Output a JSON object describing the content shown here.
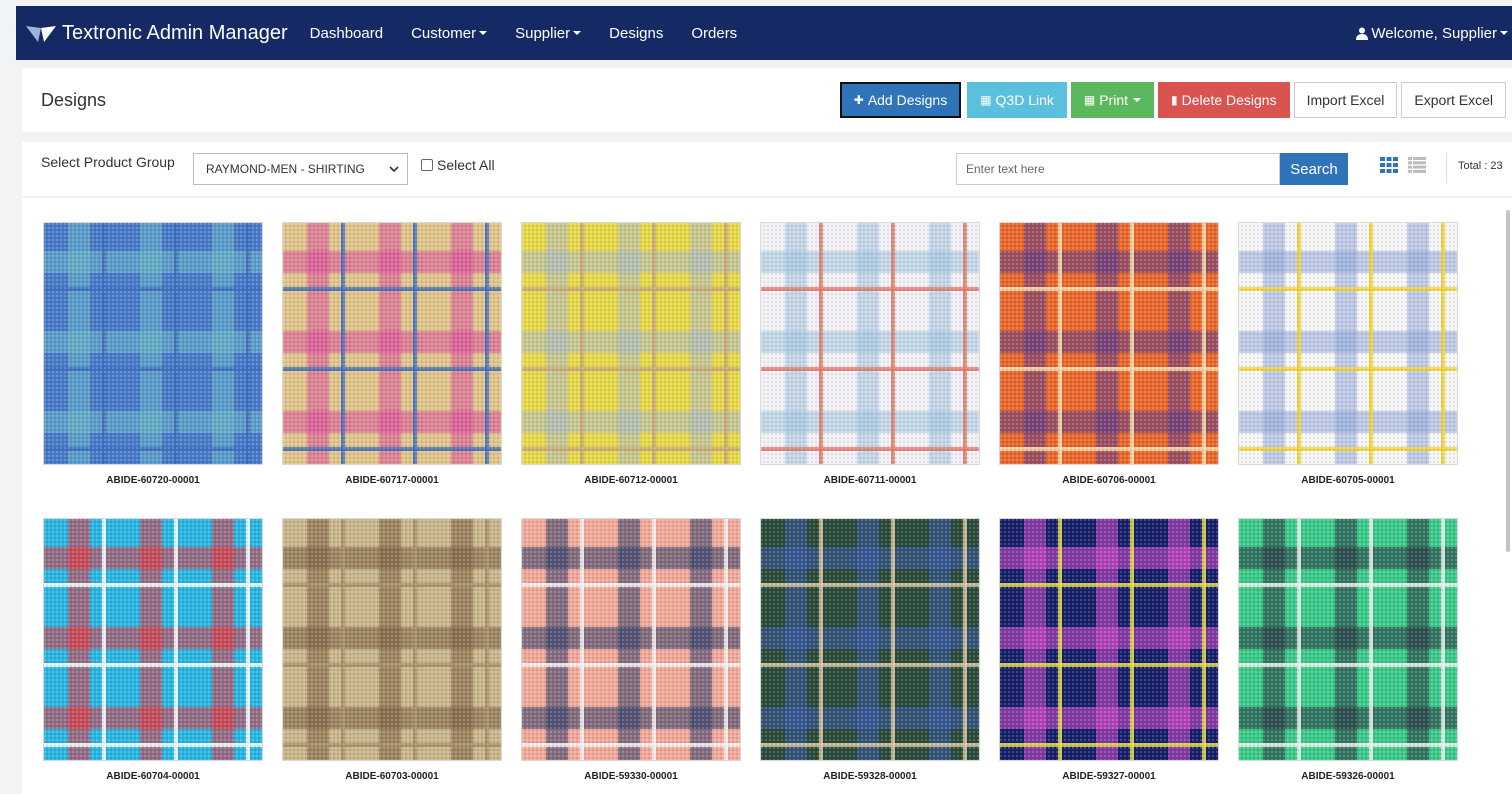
{
  "nav": {
    "brand": "Textronic Admin Manager",
    "items": [
      {
        "label": "Dashboard",
        "has_caret": false
      },
      {
        "label": "Customer",
        "has_caret": true
      },
      {
        "label": "Supplier",
        "has_caret": true
      },
      {
        "label": "Designs",
        "has_caret": false
      },
      {
        "label": "Orders",
        "has_caret": false
      }
    ],
    "welcome": "Welcome, Supplier",
    "bg_color": "#152a64"
  },
  "header": {
    "title": "Designs",
    "buttons": {
      "add": "Add Designs",
      "q3d": "Q3D Link",
      "print": "Print",
      "delete": "Delete Designs",
      "import": "Import Excel",
      "export": "Export Excel"
    }
  },
  "filter": {
    "label": "Select Product Group",
    "selected_group": "RAYMOND-MEN - SHIRTING",
    "select_all": "Select All",
    "search_placeholder": "Enter text here",
    "search_button": "Search",
    "total": "Total : 23"
  },
  "designs": [
    {
      "code": "ABIDE-60720-00001",
      "colors": [
        "#4a7bc8",
        "#6bb8c8",
        "#3f6fbf"
      ]
    },
    {
      "code": "ABIDE-60717-00001",
      "colors": [
        "#e0c48a",
        "#d94c9c",
        "#3f6fbf"
      ]
    },
    {
      "code": "ABIDE-60712-00001",
      "colors": [
        "#e8d94a",
        "#a8b8c8",
        "#c7a87a"
      ]
    },
    {
      "code": "ABIDE-60711-00001",
      "colors": [
        "#f2f2f6",
        "#9fc0dc",
        "#e07a6a"
      ]
    },
    {
      "code": "ABIDE-60706-00001",
      "colors": [
        "#e8672c",
        "#5a3a8a",
        "#f3e0b0"
      ]
    },
    {
      "code": "ABIDE-60705-00001",
      "colors": [
        "#f5f5f5",
        "#8fa6d8",
        "#f2d22a"
      ]
    },
    {
      "code": "ABIDE-60704-00001",
      "colors": [
        "#2ab4e0",
        "#e8323c",
        "#ffffff"
      ]
    },
    {
      "code": "ABIDE-60703-00001",
      "colors": [
        "#c8b68a",
        "#7a5a40",
        "#a8906a"
      ]
    },
    {
      "code": "ABIDE-59330-00001",
      "colors": [
        "#f0a898",
        "#2a3a6a",
        "#f5f5f5"
      ]
    },
    {
      "code": "ABIDE-59328-00001",
      "colors": [
        "#2a4a3a",
        "#3a5aa8",
        "#d8c8a0"
      ]
    },
    {
      "code": "ABIDE-59327-00001",
      "colors": [
        "#17216a",
        "#d84ad0",
        "#e8e04a"
      ]
    },
    {
      "code": "ABIDE-59326-00001",
      "colors": [
        "#3ac888",
        "#2a3040",
        "#f0f0f0"
      ]
    }
  ]
}
